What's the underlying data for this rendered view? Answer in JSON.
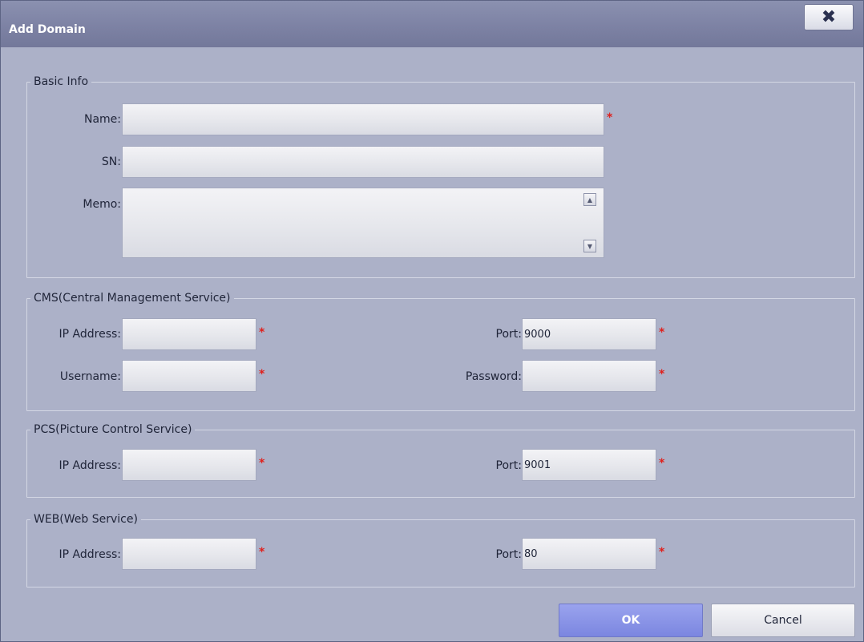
{
  "window": {
    "title": "Add Domain",
    "close_glyph": "✖",
    "close_icon": "close-icon"
  },
  "basic_info": {
    "legend": "Basic Info",
    "name_label": "Name:",
    "name_value": "",
    "sn_label": "SN:",
    "sn_value": "",
    "memo_label": "Memo:",
    "memo_value": "",
    "scroll_up_glyph": "▲",
    "scroll_down_glyph": "▼"
  },
  "cms": {
    "legend": "CMS(Central Management Service)",
    "ip_label": "IP Address:",
    "ip_value": "",
    "port_label": "Port:",
    "port_value": "9000",
    "username_label": "Username:",
    "username_value": "",
    "password_label": "Password:",
    "password_value": ""
  },
  "pcs": {
    "legend": "PCS(Picture Control Service)",
    "ip_label": "IP Address:",
    "ip_value": "",
    "port_label": "Port:",
    "port_value": "9001"
  },
  "web": {
    "legend": "WEB(Web Service)",
    "ip_label": "IP Address:",
    "ip_value": "",
    "port_label": "Port:",
    "port_value": "80"
  },
  "required_marker": "*",
  "buttons": {
    "ok": "OK",
    "cancel": "Cancel"
  },
  "colors": {
    "accent": "#7b86e0",
    "required": "#e0201c",
    "dialog_bg": "#acb1c8"
  }
}
